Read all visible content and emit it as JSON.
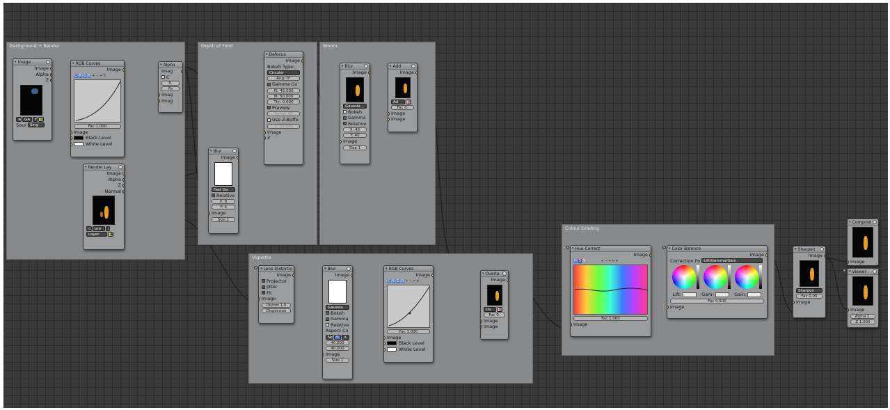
{
  "frames": {
    "background_render": "Background + Render",
    "depth_of_field": "Depth of Field",
    "bloom": "Bloom",
    "vignette": "Vignette",
    "colour_grading": "Colour Grading"
  },
  "nodes": {
    "image": {
      "title": "Image",
      "outputs": [
        "Image",
        "Alpha",
        "Z"
      ],
      "btn1": "GA",
      "btn2": "F",
      "source_label": "Sour",
      "source_value": "Sing"
    },
    "rgb_curves_1": {
      "title": "RGB Curves",
      "output": "Image",
      "channels": [
        "C",
        "R",
        "G",
        "B"
      ],
      "fac": "Fac 1.000",
      "inputs": [
        "Image",
        "Black Level",
        "White Level"
      ]
    },
    "alpha_over": {
      "title": "Alpha",
      "rows": [
        "Imag",
        "C",
        "0.",
        "Fa",
        "Imag",
        "Imag"
      ]
    },
    "render_layers": {
      "title": "Render Lay",
      "outputs": [
        "Image",
        "Alpha",
        "Z",
        "Normal"
      ],
      "scene": "pro",
      "layer": "Layer"
    },
    "blur_dof": {
      "title": "Blur",
      "output": "Image",
      "filter": "Fast Ga",
      "relative": "Relative",
      "x": "X: 6",
      "y": "Y: 6",
      "input": "Image",
      "size": "Size 1"
    },
    "defocus": {
      "title": "Defocus",
      "output": "Image",
      "bokeh_type_label": "Bokeh Type:",
      "bokeh_type": "Circular",
      "angle": "Ang: 0°",
      "gamma": "Gamma Co",
      "fstop": "fS: 45.000",
      "maxblur": "M: 50.000",
      "threshold": "Thr: 0.000",
      "preview": "Preview",
      "samples": "Samp: 16",
      "use_zbuffer": "Use Z-Buffe",
      "zscale": "Z: 10.000",
      "inputs": [
        "Image",
        "Z"
      ]
    },
    "blur_bloom": {
      "title": "Blur",
      "output": "Image",
      "filter": "Gaussia",
      "bokeh": "Bokeh",
      "gamma": "Gamma",
      "relative": "Relative",
      "x": "X: 40",
      "y": "Y: 40",
      "input": "Image",
      "size": "Size 1"
    },
    "add": {
      "title": "Add",
      "output": "Image",
      "mode": "Ad",
      "fac": "Fac 0.",
      "inputs": [
        "Image",
        "Image"
      ]
    },
    "lens_distortion": {
      "title": "Lens Distortio",
      "output": "Image",
      "projector": "Projector",
      "jitter": "Jitter",
      "fit": "Fit",
      "input": "Image",
      "distort": "Distort 1.0",
      "dispersion": "Dispersion"
    },
    "blur_vig": {
      "title": "Blur",
      "output": "Image",
      "filter": "Gaussia",
      "bokeh": "Bokeh",
      "gamma": "Gamma",
      "relative": "Relative",
      "aspect_label": "Aspect Co",
      "aspect_opts": [
        "No",
        "Y",
        "X"
      ],
      "v1": "40.000",
      "v2": "40.000",
      "input": "Image",
      "size": "Size 1"
    },
    "rgb_curves_2": {
      "title": "RGB Curves",
      "output": "Image",
      "channels": [
        "C",
        "R",
        "G",
        "B"
      ],
      "fac": "Fac 1.000",
      "inputs": [
        "Image",
        "Black Level",
        "White Level"
      ]
    },
    "overlay": {
      "title": "Overla",
      "output": "Image",
      "mode": "Ov",
      "fac": "Fac 0.",
      "inputs": [
        "Image",
        "Image"
      ]
    },
    "hue_correct": {
      "title": "Hue Correct",
      "output": "Image",
      "channels": [
        "H",
        "S",
        "V"
      ],
      "fac": "Fac 1.000",
      "input": "Image"
    },
    "color_balance": {
      "title": "Color Balance",
      "output": "Image",
      "correction_label": "Correction Fo",
      "correction_value": "Lift/Gamma/Gain",
      "lift": "Lift:",
      "gam": "Gam:",
      "gain": "Gain:",
      "fac": "Fac 0.500",
      "input": "Image"
    },
    "sharpen": {
      "title": "Sharpen",
      "output": "Image",
      "mode": "Sharpen",
      "fac": "Fac 0.05",
      "input": "Image"
    },
    "composite": {
      "title": "Composite",
      "input": "Image"
    },
    "viewer": {
      "title": "Viewer",
      "inputs": [
        "Image"
      ],
      "alpha": "Alpha 1.",
      "z": "Z 1.000"
    }
  },
  "colors": {
    "socket": "#e3e34a",
    "background": "#393939",
    "frame": "#87898b"
  }
}
